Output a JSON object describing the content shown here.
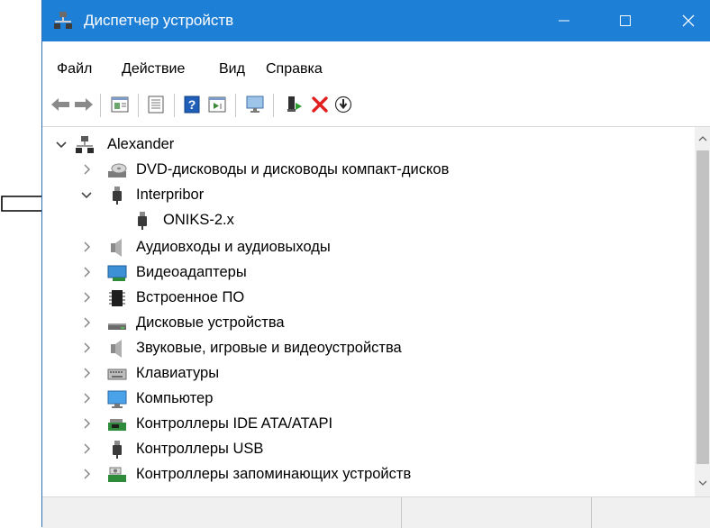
{
  "window": {
    "title": "Диспетчер устройств",
    "accent_color": "#1e7fd6",
    "title_icon": "device-manager-icon"
  },
  "menu": {
    "items": [
      "Файл",
      "Действие",
      "Вид",
      "Справка"
    ]
  },
  "toolbar": {
    "buttons": [
      "back-icon",
      "forward-icon",
      "properties-icon",
      "show-hidden-icon",
      "help-icon",
      "run-action-icon",
      "scan-hardware-icon",
      "update-driver-icon",
      "uninstall-icon",
      "disable-device-icon"
    ]
  },
  "tree": {
    "root": {
      "label": "Alexander",
      "expanded": true,
      "icon": "computer-root-icon"
    },
    "items": [
      {
        "label": "DVD-дисководы и дисководы компакт-дисков",
        "icon": "dvd-drive-icon",
        "expanded": false
      },
      {
        "label": "Interpribor",
        "icon": "usb-plug-icon",
        "expanded": true,
        "children": [
          {
            "label": "ONIKS-2.x",
            "icon": "usb-plug-icon",
            "selected": true
          }
        ]
      },
      {
        "label": "Аудиовходы и аудиовыходы",
        "icon": "speaker-icon",
        "expanded": false
      },
      {
        "label": "Видеоадаптеры",
        "icon": "display-adapter-icon",
        "expanded": false
      },
      {
        "label": "Встроенное ПО",
        "icon": "firmware-chip-icon",
        "expanded": false
      },
      {
        "label": "Дисковые устройства",
        "icon": "disk-drive-icon",
        "expanded": false
      },
      {
        "label": "Звуковые, игровые и видеоустройства",
        "icon": "speaker-icon",
        "expanded": false
      },
      {
        "label": "Клавиатуры",
        "icon": "keyboard-icon",
        "expanded": false
      },
      {
        "label": "Компьютер",
        "icon": "monitor-icon",
        "expanded": false
      },
      {
        "label": "Контроллеры IDE ATA/ATAPI",
        "icon": "ide-controller-icon",
        "expanded": false
      },
      {
        "label": "Контроллеры USB",
        "icon": "usb-plug-icon",
        "expanded": false
      },
      {
        "label": "Контроллеры запоминающих устройств",
        "icon": "storage-controller-icon",
        "expanded": false
      }
    ]
  },
  "annotation": {
    "icon": "pointer-arrow-icon"
  }
}
